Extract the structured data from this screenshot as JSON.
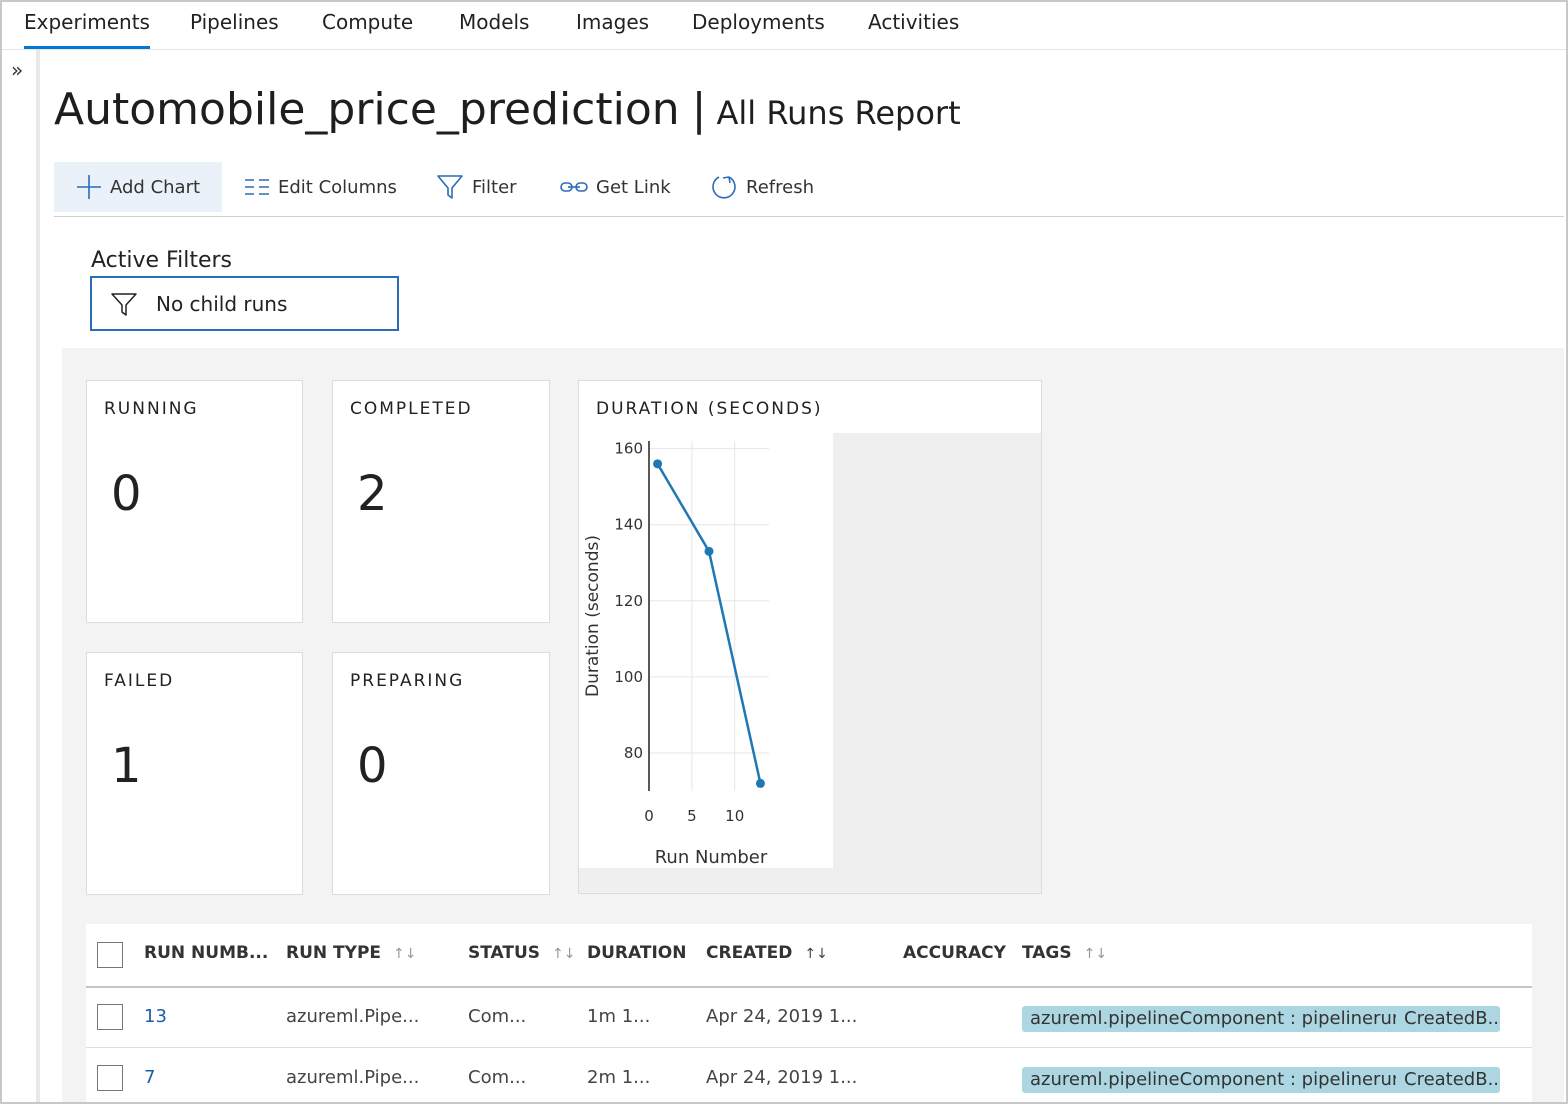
{
  "nav": {
    "tabs": [
      {
        "label": "Experiments",
        "active": true
      },
      {
        "label": "Pipelines"
      },
      {
        "label": "Compute"
      },
      {
        "label": "Models"
      },
      {
        "label": "Images"
      },
      {
        "label": "Deployments"
      },
      {
        "label": "Activities"
      }
    ],
    "accent": "#0078d4"
  },
  "rail": {
    "expand_glyph": "»"
  },
  "header": {
    "title": "Automobile_price_prediction",
    "separator": "|",
    "subtitle": "All Runs Report"
  },
  "toolbar": {
    "add_chart": "Add Chart",
    "edit_columns": "Edit Columns",
    "filter": "Filter",
    "get_link": "Get Link",
    "refresh": "Refresh"
  },
  "filters": {
    "label": "Active Filters",
    "items": [
      "No child runs"
    ]
  },
  "cards": {
    "running": {
      "label": "RUNNING",
      "value": "0"
    },
    "completed": {
      "label": "COMPLETED",
      "value": "2"
    },
    "failed": {
      "label": "FAILED",
      "value": "1"
    },
    "preparing": {
      "label": "PREPARING",
      "value": "0"
    }
  },
  "chart_data": {
    "type": "line",
    "title": "DURATION (SECONDS)",
    "xlabel": "Run Number",
    "ylabel": "Duration (seconds)",
    "x": [
      1,
      7,
      13
    ],
    "y": [
      156,
      133,
      72
    ],
    "xlim": [
      0,
      14
    ],
    "ylim": [
      70,
      162
    ],
    "xticks": [
      0,
      5,
      10
    ],
    "yticks": [
      80,
      100,
      120,
      140,
      160
    ],
    "grid": true,
    "color": "#1f77b4"
  },
  "table": {
    "columns": [
      {
        "label": "RUN NUMB...",
        "sortable": false
      },
      {
        "label": "RUN TYPE",
        "sortable": true
      },
      {
        "label": "STATUS",
        "sortable": true
      },
      {
        "label": "DURATION",
        "sortable": false
      },
      {
        "label": "CREATED",
        "sortable": true,
        "sorted": true
      },
      {
        "label": "ACCURACY",
        "sortable": false
      },
      {
        "label": "TAGS",
        "sortable": true
      }
    ],
    "rows": [
      {
        "run_number": "13",
        "run_type": "azureml.Pipe...",
        "status": "Com...",
        "duration": "1m 1...",
        "created": "Apr 24, 2019 1...",
        "accuracy": "",
        "tags": [
          "azureml.pipelineComponent : pipelinerun",
          "CreatedB..."
        ]
      },
      {
        "run_number": "7",
        "run_type": "azureml.Pipe...",
        "status": "Com...",
        "duration": "2m 1...",
        "created": "Apr 24, 2019 1...",
        "accuracy": "",
        "tags": [
          "azureml.pipelineComponent : pipelinerun",
          "CreatedB..."
        ]
      }
    ]
  }
}
